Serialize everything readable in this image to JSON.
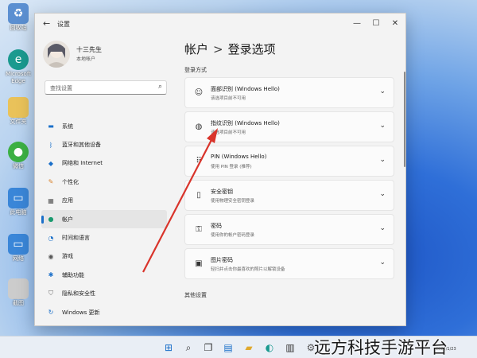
{
  "desktop": {
    "icons": [
      {
        "label": "回收站",
        "icon": "recycle-bin-icon",
        "color": "#5b8fd1"
      },
      {
        "label": "Microsoft Edge",
        "icon": "edge-icon",
        "color": "#1a9a8f"
      },
      {
        "label": "文件夹",
        "icon": "folder-icon",
        "color": "#e9c25a"
      },
      {
        "label": "微信",
        "icon": "wechat-icon",
        "color": "#3cb043"
      },
      {
        "label": "此电脑",
        "icon": "monitor-icon",
        "color": "#3a86d8"
      },
      {
        "label": "网络",
        "icon": "network-icon",
        "color": "#3a86d8"
      },
      {
        "label": "截图",
        "icon": "image-file-icon",
        "color": "#cccccc"
      }
    ]
  },
  "window": {
    "title": "设置",
    "minimize": "—",
    "maximize": "☐",
    "close": "✕"
  },
  "user": {
    "name": "十三先生",
    "subtitle": "本地帐户"
  },
  "search": {
    "placeholder": "查找设置"
  },
  "nav": {
    "items": [
      {
        "label": "系统",
        "icon": "monitor-icon",
        "active": false
      },
      {
        "label": "蓝牙和其他设备",
        "icon": "bluetooth-icon",
        "active": false
      },
      {
        "label": "网络和 Internet",
        "icon": "wifi-icon",
        "active": false
      },
      {
        "label": "个性化",
        "icon": "brush-icon",
        "active": false
      },
      {
        "label": "应用",
        "icon": "apps-icon",
        "active": false
      },
      {
        "label": "帐户",
        "icon": "person-icon",
        "active": true
      },
      {
        "label": "时间和语言",
        "icon": "globe-icon",
        "active": false
      },
      {
        "label": "游戏",
        "icon": "gamepad-icon",
        "active": false
      },
      {
        "label": "辅助功能",
        "icon": "accessibility-icon",
        "active": false
      },
      {
        "label": "隐私和安全性",
        "icon": "shield-icon",
        "active": false
      },
      {
        "label": "Windows 更新",
        "icon": "update-icon",
        "active": false
      }
    ]
  },
  "page": {
    "breadcrumb_parent": "帐户",
    "breadcrumb_sep": ">",
    "breadcrumb_current": "登录选项",
    "section_login": "登录方式",
    "section_other": "其他设置"
  },
  "options": [
    {
      "title": "面部识别 (Windows Hello)",
      "subtitle": "该选项目前不可用",
      "icon": "smile-icon"
    },
    {
      "title": "指纹识别 (Windows Hello)",
      "subtitle": "该选项目前不可用",
      "icon": "fingerprint-icon"
    },
    {
      "title": "PIN (Windows Hello)",
      "subtitle": "使用 PIN 登录 (推荐)",
      "icon": "keypad-icon"
    },
    {
      "title": "安全密钥",
      "subtitle": "使用物理安全密钥登录",
      "icon": "usb-key-icon"
    },
    {
      "title": "密码",
      "subtitle": "使用你的帐户密码登录",
      "icon": "key-icon"
    },
    {
      "title": "图片密码",
      "subtitle": "轻扫并点击你最喜欢的照片以解锁设备",
      "icon": "picture-icon"
    }
  ],
  "taskbar": {
    "items": [
      "start-icon",
      "search-icon",
      "task-view-icon",
      "widgets-icon",
      "file-explorer-icon",
      "edge-icon",
      "store-icon",
      "settings-icon"
    ],
    "clock_date": "2022/1/23"
  },
  "watermark": "远方科技手游平台",
  "colors": {
    "accent": "#1a6fc9",
    "arrow": "#d9342b"
  }
}
